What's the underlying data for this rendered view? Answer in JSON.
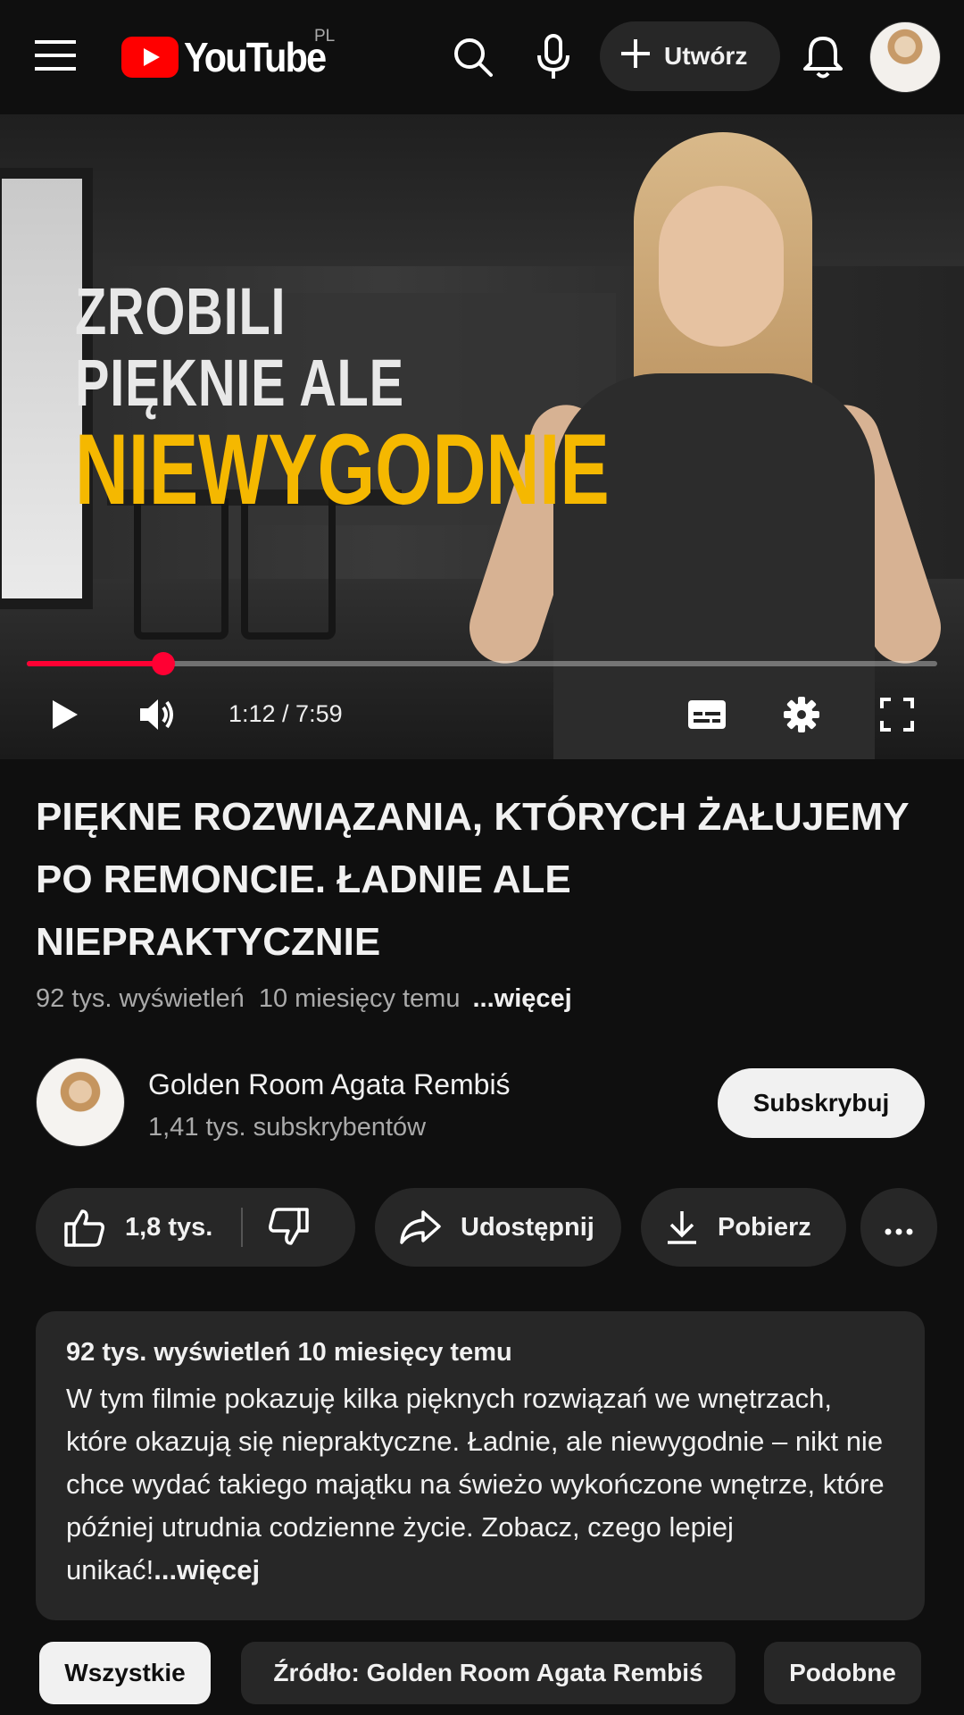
{
  "header": {
    "logo_text": "YouTube",
    "region": "PL",
    "create_label": "Utwórz",
    "icons": [
      "menu-icon",
      "search-icon",
      "mic-icon",
      "plus-icon",
      "bell-icon"
    ]
  },
  "player": {
    "thumbnail_lines": [
      "ZROBILI",
      "PIĘKNIE ALE",
      "NIEWYGODNIE"
    ],
    "time_display": "1:12 / 7:59",
    "progress": 0.15,
    "colors": {
      "progress": "#ff0033",
      "highlight_text": "#f5b800"
    }
  },
  "video": {
    "title": "PIĘKNE ROZWIĄZANIA, KTÓRYCH ŻAŁUJEMY PO REMONCIE. ŁADNIE ALE NIEPRAKTYCZNIE",
    "views": "92 tys. wyświetleń",
    "age": "10 miesięcy temu",
    "more_label": "...więcej"
  },
  "channel": {
    "name": "Golden Room Agata Rembiś",
    "subscribers": "1,41 tys. subskrybentów",
    "subscribe_label": "Subskrybuj"
  },
  "actions": {
    "likes": "1,8 tys.",
    "share_label": "Udostępnij",
    "download_label": "Pobierz"
  },
  "description": {
    "meta": "92 tys. wyświetleń  10 miesięcy temu",
    "text": "W tym filmie pokazuję kilka pięknych rozwiązań we wnętrzach, które okazują się niepraktyczne. Ładnie, ale niewygodnie – nikt nie chce wydać takiego majątku na świeżo wykończone wnętrze, które później utrudnia codzienne życie. Zobacz, czego lepiej unikać!",
    "more_label": "...więcej"
  },
  "chips": [
    "Wszystkie",
    "Źródło: Golden Room Agata Rembiś",
    "Podobne"
  ]
}
